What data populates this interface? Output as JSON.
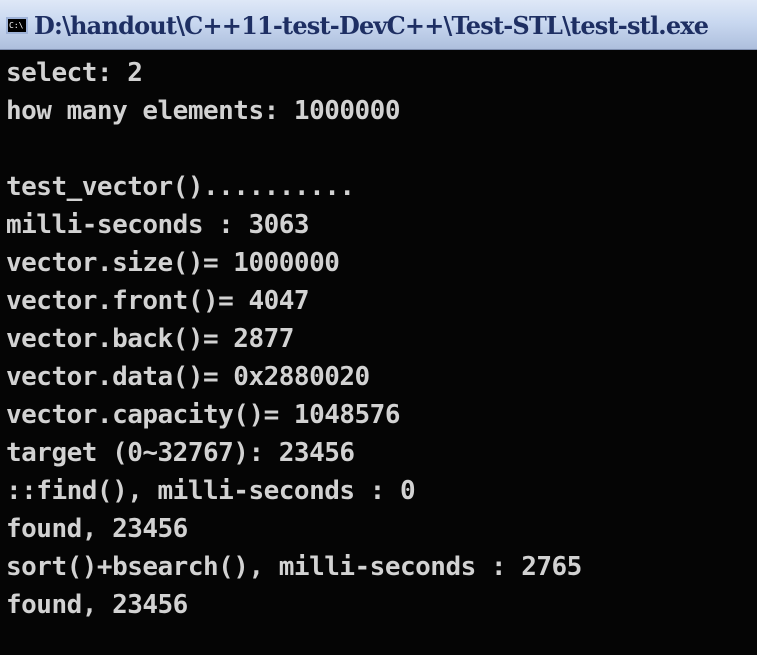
{
  "window": {
    "title": "D:\\handout\\C++11-test-DevC++\\Test-STL\\test-stl.exe",
    "icon": "console-app-icon",
    "icon_text": "C:\\"
  },
  "console": {
    "lines": [
      "select: 2",
      "how many elements: 1000000",
      "",
      "test_vector()..........",
      "milli-seconds : 3063",
      "vector.size()= 1000000",
      "vector.front()= 4047",
      "vector.back()= 2877",
      "vector.data()= 0x2880020",
      "vector.capacity()= 1048576",
      "target (0~32767): 23456",
      "::find(), milli-seconds : 0",
      "found, 23456",
      "sort()+bsearch(), milli-seconds : 2765",
      "found, 23456"
    ]
  },
  "colors": {
    "console_background": "#050505",
    "console_text": "#d2d2d2",
    "titlebar_text": "#1e2f63"
  }
}
